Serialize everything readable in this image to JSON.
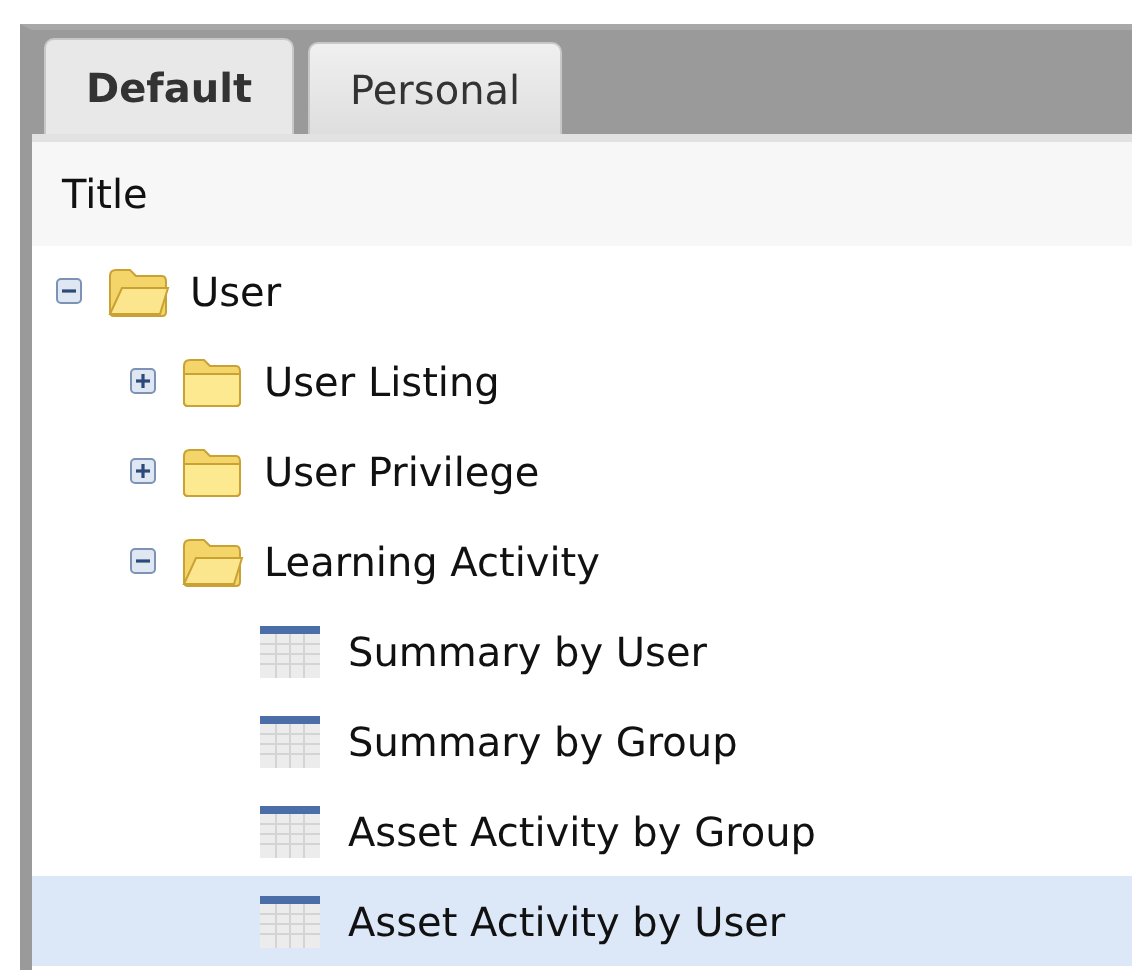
{
  "tabs": [
    {
      "label": "Default",
      "selected": true
    },
    {
      "label": "Personal",
      "selected": false
    }
  ],
  "column_header": "Title",
  "tree": [
    {
      "label": "User",
      "kind": "folder",
      "expanded": true,
      "selected": false,
      "children": [
        {
          "label": "User Listing",
          "kind": "folder",
          "expanded": false,
          "selected": false
        },
        {
          "label": "User Privilege",
          "kind": "folder",
          "expanded": false,
          "selected": false
        },
        {
          "label": "Learning Activity",
          "kind": "folder",
          "expanded": true,
          "selected": false,
          "children": [
            {
              "label": "Summary by User",
              "kind": "report",
              "selected": false
            },
            {
              "label": "Summary by Group",
              "kind": "report",
              "selected": false
            },
            {
              "label": "Asset Activity by Group",
              "kind": "report",
              "selected": false
            },
            {
              "label": "Asset Activity by User",
              "kind": "report",
              "selected": true
            }
          ]
        }
      ]
    }
  ]
}
